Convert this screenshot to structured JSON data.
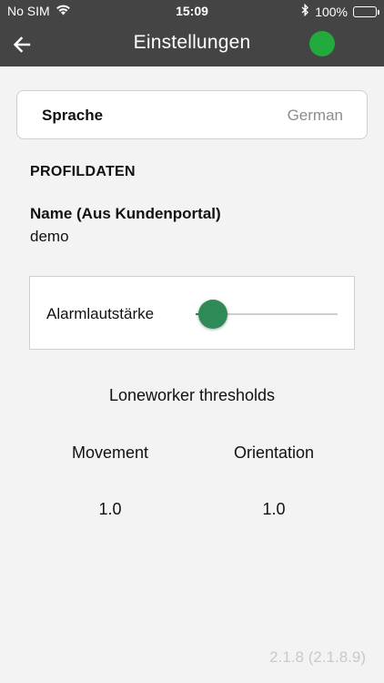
{
  "status_bar": {
    "carrier": "No SIM",
    "time": "15:09",
    "battery_percent": "100%",
    "battery_level": 1.0
  },
  "navbar": {
    "title": "Einstellungen",
    "status_color": "#22aa3c"
  },
  "language": {
    "label": "Sprache",
    "value": "German"
  },
  "profile": {
    "section_title": "PROFILDATEN",
    "name_label": "Name (Aus Kundenportal)",
    "name_value": "demo"
  },
  "alarm_volume": {
    "label": "Alarmlautstärke",
    "level": 0.12,
    "accent_color": "#2e8b57"
  },
  "loneworker": {
    "title": "Loneworker thresholds",
    "columns": [
      {
        "label": "Movement",
        "value": "1.0"
      },
      {
        "label": "Orientation",
        "value": "1.0"
      }
    ]
  },
  "version": "2.1.8 (2.1.8.9)"
}
